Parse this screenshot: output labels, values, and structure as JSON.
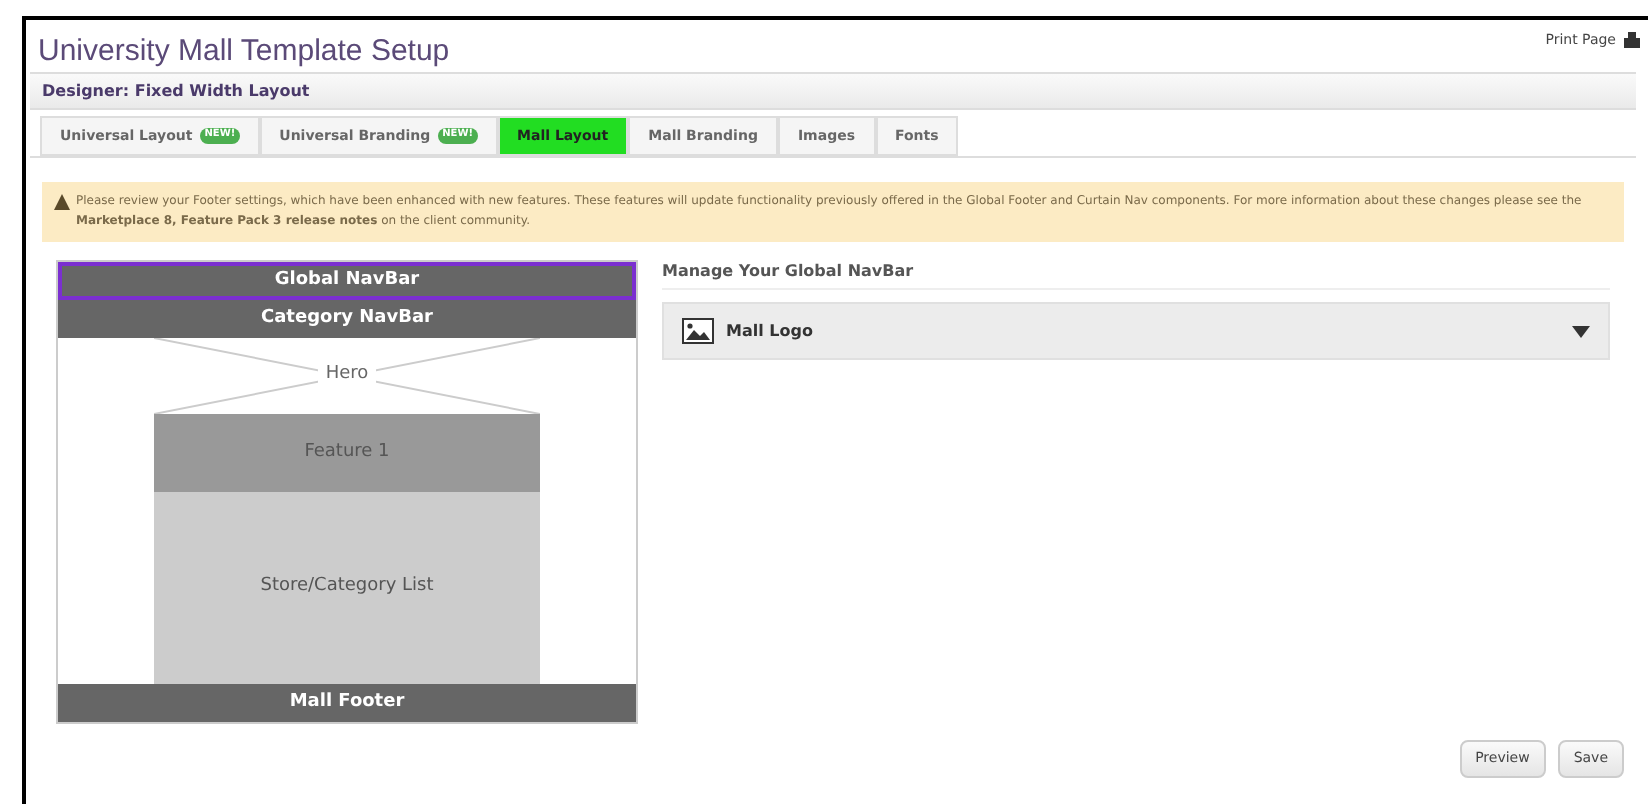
{
  "page": {
    "title": "University Mall Template Setup",
    "print_link": "Print Page"
  },
  "designer_bar": {
    "title": "Designer: Fixed Width Layout"
  },
  "tabs": [
    {
      "label": "Universal Layout",
      "badge": "NEW!",
      "selected": false
    },
    {
      "label": "Universal Branding",
      "badge": "NEW!",
      "selected": false
    },
    {
      "label": "Mall Layout",
      "selected": true
    },
    {
      "label": "Mall Branding",
      "selected": false
    },
    {
      "label": "Images",
      "selected": false
    },
    {
      "label": "Fonts",
      "selected": false
    }
  ],
  "alert": {
    "text": "Please review your Footer settings, which have been enhanced with new features. These features will update functionality previously offered in the Global Footer and Curtain Nav components. For more information about these changes please see the **Marketplace 8, Feature Pack 3 release notes** on the client community."
  },
  "layout_blocks": [
    {
      "kind": "bar",
      "label": "Global NavBar",
      "selected": true
    },
    {
      "kind": "bar",
      "label": "Category NavBar",
      "selected": false
    },
    {
      "kind": "hero",
      "label": "Hero",
      "selected": false
    },
    {
      "kind": "feature",
      "label": "Feature 1",
      "selected": false
    },
    {
      "kind": "list",
      "label": "Store/Category List",
      "selected": false
    },
    {
      "kind": "bar",
      "label": "Mall Footer",
      "selected": false
    }
  ],
  "panel": {
    "heading": "Manage Your Global NavBar",
    "items": [
      {
        "label": "Mall Logo",
        "expanded": false
      }
    ]
  },
  "buttons": [
    "Preview",
    "Save"
  ]
}
